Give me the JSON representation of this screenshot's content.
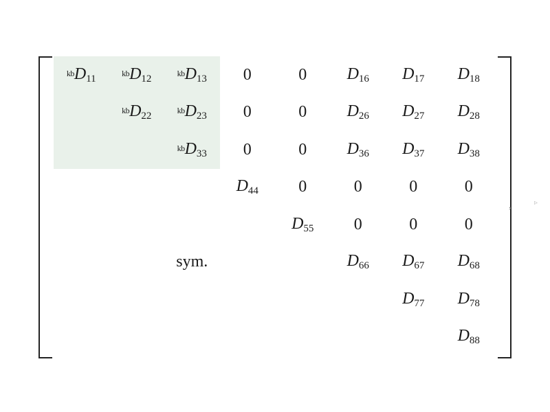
{
  "prefix": "kb",
  "symLabel": "sym.",
  "matrix": [
    [
      {
        "t": "D",
        "p": "kb",
        "s": "11",
        "hl": true
      },
      {
        "t": "D",
        "p": "kb",
        "s": "12",
        "hl": true
      },
      {
        "t": "D",
        "p": "kb",
        "s": "13",
        "hl": true
      },
      {
        "t": "0"
      },
      {
        "t": "0"
      },
      {
        "t": "D",
        "s": "16"
      },
      {
        "t": "D",
        "s": "17"
      },
      {
        "t": "D",
        "s": "18"
      }
    ],
    [
      {
        "t": "",
        "hl": true
      },
      {
        "t": "D",
        "p": "kb",
        "s": "22",
        "hl": true
      },
      {
        "t": "D",
        "p": "kb",
        "s": "23",
        "hl": true
      },
      {
        "t": "0"
      },
      {
        "t": "0"
      },
      {
        "t": "D",
        "s": "26"
      },
      {
        "t": "D",
        "s": "27"
      },
      {
        "t": "D",
        "s": "28"
      }
    ],
    [
      {
        "t": "",
        "hl": true
      },
      {
        "t": "",
        "hl": true
      },
      {
        "t": "D",
        "p": "kb",
        "s": "33",
        "hl": true
      },
      {
        "t": "0"
      },
      {
        "t": "0"
      },
      {
        "t": "D",
        "s": "36"
      },
      {
        "t": "D",
        "s": "37"
      },
      {
        "t": "D",
        "s": "38"
      }
    ],
    [
      {
        "t": ""
      },
      {
        "t": ""
      },
      {
        "t": ""
      },
      {
        "t": "D",
        "s": "44"
      },
      {
        "t": "0"
      },
      {
        "t": "0"
      },
      {
        "t": "0"
      },
      {
        "t": "0"
      }
    ],
    [
      {
        "t": ""
      },
      {
        "t": ""
      },
      {
        "t": ""
      },
      {
        "t": ""
      },
      {
        "t": "D",
        "s": "55"
      },
      {
        "t": "0"
      },
      {
        "t": "0"
      },
      {
        "t": "0"
      }
    ],
    [
      {
        "t": ""
      },
      {
        "t": ""
      },
      {
        "t": "sym"
      },
      {
        "t": ""
      },
      {
        "t": ""
      },
      {
        "t": "D",
        "s": "66"
      },
      {
        "t": "D",
        "s": "67"
      },
      {
        "t": "D",
        "s": "68"
      }
    ],
    [
      {
        "t": ""
      },
      {
        "t": ""
      },
      {
        "t": ""
      },
      {
        "t": ""
      },
      {
        "t": ""
      },
      {
        "t": ""
      },
      {
        "t": "D",
        "s": "77"
      },
      {
        "t": "D",
        "s": "78"
      }
    ],
    [
      {
        "t": ""
      },
      {
        "t": ""
      },
      {
        "t": ""
      },
      {
        "t": ""
      },
      {
        "t": ""
      },
      {
        "t": ""
      },
      {
        "t": ""
      },
      {
        "t": "D",
        "s": "88"
      }
    ]
  ],
  "trailingComma": ","
}
